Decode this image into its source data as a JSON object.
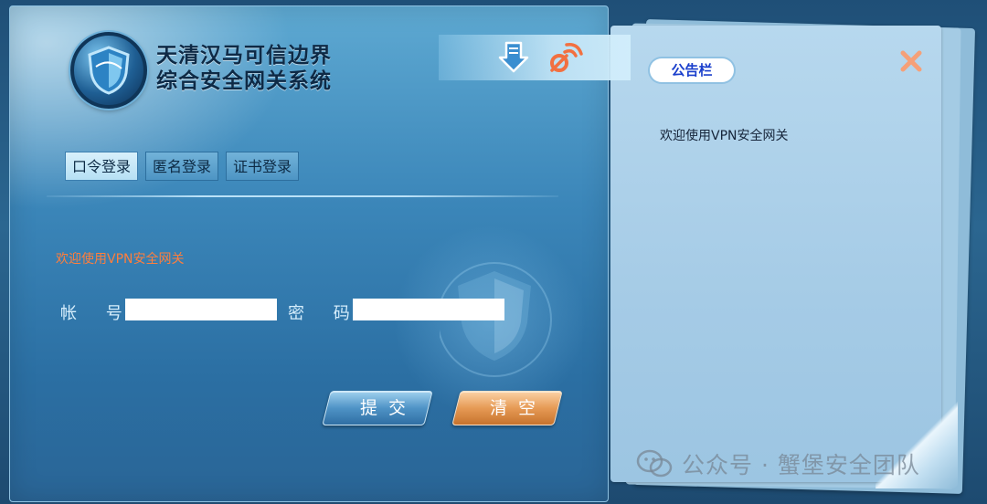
{
  "product": {
    "title_line1": "天清汉马可信边界",
    "title_line2": "综合安全网关系统"
  },
  "login": {
    "tabs": [
      {
        "label": "口令登录",
        "active": true
      },
      {
        "label": "匿名登录",
        "active": false
      },
      {
        "label": "证书登录",
        "active": false
      }
    ],
    "welcome": "欢迎使用VPN安全网关",
    "account_label": "帐 号:",
    "account_value": "",
    "password_label": "密 码:",
    "password_value": "",
    "submit_label": "提交",
    "clear_label": "清空"
  },
  "toolbar": {
    "download_icon": "download-arrow-icon",
    "signal_icon": "broadcast-signal-icon"
  },
  "notice": {
    "tag": "公告栏",
    "content": "欢迎使用VPN安全网关",
    "close_icon": "close-x-icon"
  },
  "watermark": {
    "text": "公众号 · 蟹堡安全团队",
    "icon": "wechat-icon"
  },
  "colors": {
    "welcome_text": "#ff7e3c",
    "notice_tag_text": "#1a3fcc",
    "submit_button": "#4f93c6",
    "clear_button": "#e69a55"
  }
}
